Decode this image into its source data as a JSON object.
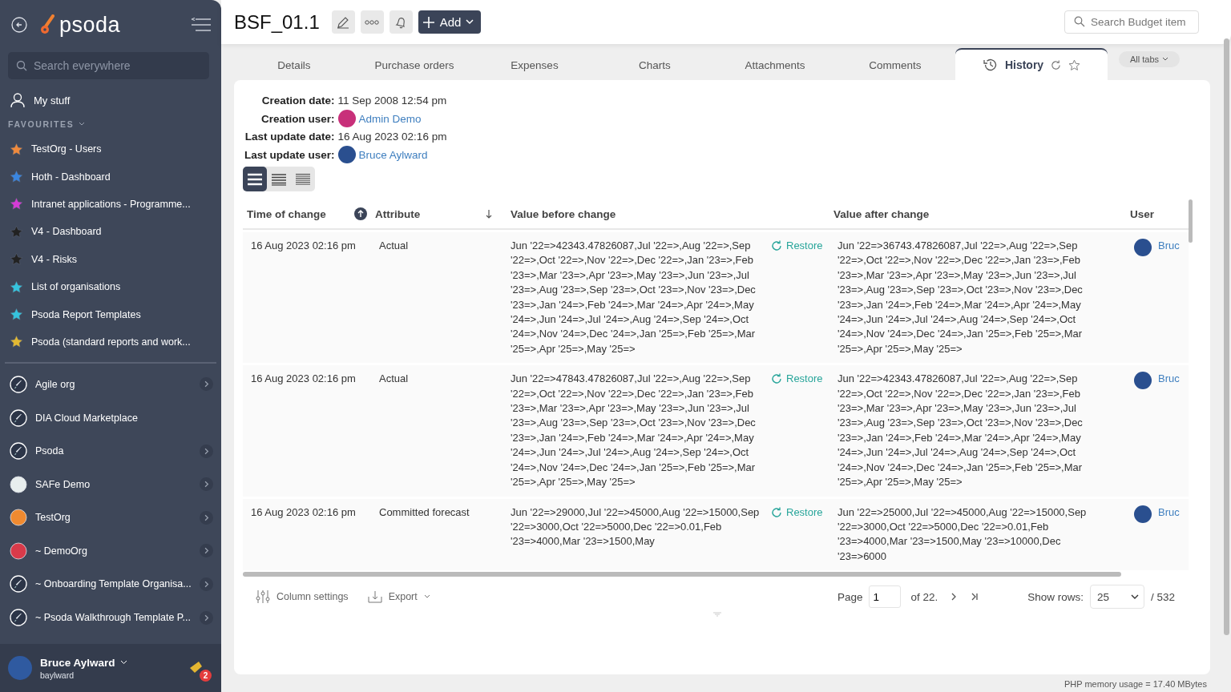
{
  "sidebar": {
    "logo": "psoda",
    "search": {
      "placeholder": "Search everywhere"
    },
    "my_stuff": "My stuff",
    "favourites_heading": "FAVOURITES",
    "favourites": [
      {
        "label": "TestOrg - Users",
        "color": "#f08a3c"
      },
      {
        "label": "Hoth - Dashboard",
        "color": "#3a86e0"
      },
      {
        "label": "Intranet applications - Programme...",
        "color": "#d63bd6"
      },
      {
        "label": "V4 - Dashboard",
        "color": "#222222"
      },
      {
        "label": "V4 - Risks",
        "color": "#222222"
      },
      {
        "label": "List of organisations",
        "color": "#35c3dd"
      },
      {
        "label": "Psoda Report Templates",
        "color": "#35c3dd"
      },
      {
        "label": "Psoda (standard reports and work...",
        "color": "#e3b932"
      }
    ],
    "organisations": [
      {
        "label": "Agile org",
        "kind": "rocket",
        "expandable": true
      },
      {
        "label": "DIA Cloud Marketplace",
        "kind": "rocket",
        "expandable": false
      },
      {
        "label": "Psoda",
        "kind": "rocket",
        "expandable": true
      },
      {
        "label": "SAFe Demo",
        "kind": "logo",
        "color": "#e8eeee",
        "expandable": true
      },
      {
        "label": "TestOrg",
        "kind": "logo",
        "color": "#f08a30",
        "expandable": true
      },
      {
        "label": "~ DemoOrg",
        "kind": "logo",
        "color": "#d83a4a",
        "expandable": true
      },
      {
        "label": "~ Onboarding Template Organisa...",
        "kind": "rocket",
        "expandable": true
      },
      {
        "label": "~ Psoda Walkthrough Template P...",
        "kind": "rocket",
        "expandable": true
      }
    ],
    "user": {
      "name": "Bruce Aylward",
      "username": "baylward",
      "notifications": "2"
    }
  },
  "header": {
    "title": "BSF_01.1",
    "add_button": "Add",
    "search": {
      "placeholder": "Search Budget item"
    }
  },
  "tabs": [
    {
      "label": "Details",
      "selected": false
    },
    {
      "label": "Purchase orders",
      "selected": false
    },
    {
      "label": "Expenses",
      "selected": false
    },
    {
      "label": "Charts",
      "selected": false
    },
    {
      "label": "Attachments",
      "selected": false
    },
    {
      "label": "Comments",
      "selected": false
    },
    {
      "label": "History",
      "selected": true
    }
  ],
  "all_tabs": "All tabs",
  "record": {
    "fields": [
      {
        "label": "Creation date:",
        "value": "11 Sep 2008 12:54 pm",
        "kind": "text"
      },
      {
        "label": "Creation user:",
        "value": "Admin Demo",
        "kind": "user",
        "color": "#c8307a"
      },
      {
        "label": "Last update date:",
        "value": "16 Aug 2023 02:16 pm",
        "kind": "text"
      },
      {
        "label": "Last update user:",
        "value": "Bruce Aylward",
        "kind": "user",
        "color": "#2a4f8f"
      }
    ]
  },
  "view_modes": [
    {
      "selected": true
    },
    {
      "selected": false
    },
    {
      "selected": false
    }
  ],
  "table": {
    "columns": [
      {
        "label": "Time of change",
        "kind": "sorted"
      },
      {
        "label": "Attribute",
        "kind": "sortable"
      },
      {
        "label": "Value before change",
        "kind": "text"
      },
      {
        "label": "Value after change",
        "kind": "text"
      },
      {
        "label": "User",
        "kind": "text"
      }
    ],
    "rows": [
      {
        "time": "16 Aug 2023 02:16 pm",
        "attribute": "Actual",
        "before": "Jun '22=>42343.47826087,Jul '22=>,Aug '22=>,Sep '22=>,Oct '22=>,Nov '22=>,Dec '22=>,Jan '23=>,Feb '23=>,Mar '23=>,Apr '23=>,May '23=>,Jun '23=>,Jul '23=>,Aug '23=>,Sep '23=>,Oct '23=>,Nov '23=>,Dec '23=>,Jan '24=>,Feb '24=>,Mar '24=>,Apr '24=>,May '24=>,Jun '24=>,Jul '24=>,Aug '24=>,Sep '24=>,Oct '24=>,Nov '24=>,Dec '24=>,Jan '25=>,Feb '25=>,Mar '25=>,Apr '25=>,May '25=>",
        "restore": "Restore",
        "after": "Jun '22=>36743.47826087,Jul '22=>,Aug '22=>,Sep '22=>,Oct '22=>,Nov '22=>,Dec '22=>,Jan '23=>,Feb '23=>,Mar '23=>,Apr '23=>,May '23=>,Jun '23=>,Jul '23=>,Aug '23=>,Sep '23=>,Oct '23=>,Nov '23=>,Dec '23=>,Jan '24=>,Feb '24=>,Mar '24=>,Apr '24=>,May '24=>,Jun '24=>,Jul '24=>,Aug '24=>,Sep '24=>,Oct '24=>,Nov '24=>,Dec '24=>,Jan '25=>,Feb '25=>,Mar '25=>,Apr '25=>,May '25=>",
        "user": "Bruc"
      },
      {
        "time": "16 Aug 2023 02:16 pm",
        "attribute": "Actual",
        "before": "Jun '22=>47843.47826087,Jul '22=>,Aug '22=>,Sep '22=>,Oct '22=>,Nov '22=>,Dec '22=>,Jan '23=>,Feb '23=>,Mar '23=>,Apr '23=>,May '23=>,Jun '23=>,Jul '23=>,Aug '23=>,Sep '23=>,Oct '23=>,Nov '23=>,Dec '23=>,Jan '24=>,Feb '24=>,Mar '24=>,Apr '24=>,May '24=>,Jun '24=>,Jul '24=>,Aug '24=>,Sep '24=>,Oct '24=>,Nov '24=>,Dec '24=>,Jan '25=>,Feb '25=>,Mar '25=>,Apr '25=>,May '25=>",
        "restore": "Restore",
        "after": "Jun '22=>42343.47826087,Jul '22=>,Aug '22=>,Sep '22=>,Oct '22=>,Nov '22=>,Dec '22=>,Jan '23=>,Feb '23=>,Mar '23=>,Apr '23=>,May '23=>,Jun '23=>,Jul '23=>,Aug '23=>,Sep '23=>,Oct '23=>,Nov '23=>,Dec '23=>,Jan '24=>,Feb '24=>,Mar '24=>,Apr '24=>,May '24=>,Jun '24=>,Jul '24=>,Aug '24=>,Sep '24=>,Oct '24=>,Nov '24=>,Dec '24=>,Jan '25=>,Feb '25=>,Mar '25=>,Apr '25=>,May '25=>",
        "user": "Bruc"
      },
      {
        "time": "16 Aug 2023 02:16 pm",
        "attribute": "Committed forecast",
        "before": "Jun '22=>29000,Jul '22=>45000,Aug '22=>15000,Sep '22=>3000,Oct '22=>5000,Dec '22=>0.01,Feb '23=>4000,Mar '23=>1500,May",
        "restore": "Restore",
        "after": "Jun '22=>25000,Jul '22=>45000,Aug '22=>15000,Sep '22=>3000,Oct '22=>5000,Dec '22=>0.01,Feb '23=>4000,Mar '23=>1500,May '23=>10000,Dec '23=>6000",
        "user": "Bruc"
      }
    ]
  },
  "footer": {
    "column_settings": "Column settings",
    "export": "Export",
    "page_label": "Page",
    "page": "1",
    "of": "of 22.",
    "show_rows_label": "Show rows:",
    "rows_per_page": "25",
    "total": "/ 532"
  },
  "memory": "PHP memory usage = 17.40 MBytes"
}
